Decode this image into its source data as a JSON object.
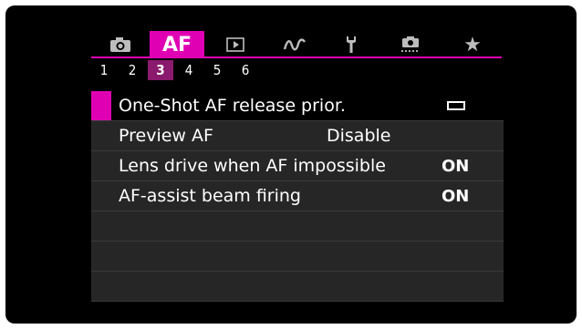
{
  "tabs": [
    {
      "name": "shooting",
      "icon": "camera-icon",
      "glyph": "",
      "active": false
    },
    {
      "name": "af",
      "icon": "",
      "label": "AF",
      "active": true
    },
    {
      "name": "playback",
      "icon": "play-icon",
      "glyph": "▶",
      "active": false
    },
    {
      "name": "wireless",
      "icon": "wireless-icon",
      "glyph": "∿",
      "active": false
    },
    {
      "name": "setup",
      "icon": "wrench-icon",
      "glyph": "",
      "active": false
    },
    {
      "name": "custom",
      "icon": "custom-function-icon",
      "glyph": "",
      "active": false
    },
    {
      "name": "mymenu",
      "icon": "star-icon",
      "glyph": "★",
      "active": false
    }
  ],
  "pages": [
    "1",
    "2",
    "3",
    "4",
    "5",
    "6"
  ],
  "active_page": "3",
  "menu": {
    "items": [
      {
        "label": "One-Shot AF release prior.",
        "value": "",
        "value_icon": "release-priority-icon"
      },
      {
        "label": "Preview AF",
        "value": "Disable"
      },
      {
        "label": "Lens drive when AF impossible",
        "value": "ON"
      },
      {
        "label": "AF-assist beam firing",
        "value": "ON"
      }
    ]
  },
  "colors": {
    "accent": "#e000b4",
    "page_active": "#8a1a6e",
    "row_bg": "#262626",
    "bg": "#000000"
  }
}
